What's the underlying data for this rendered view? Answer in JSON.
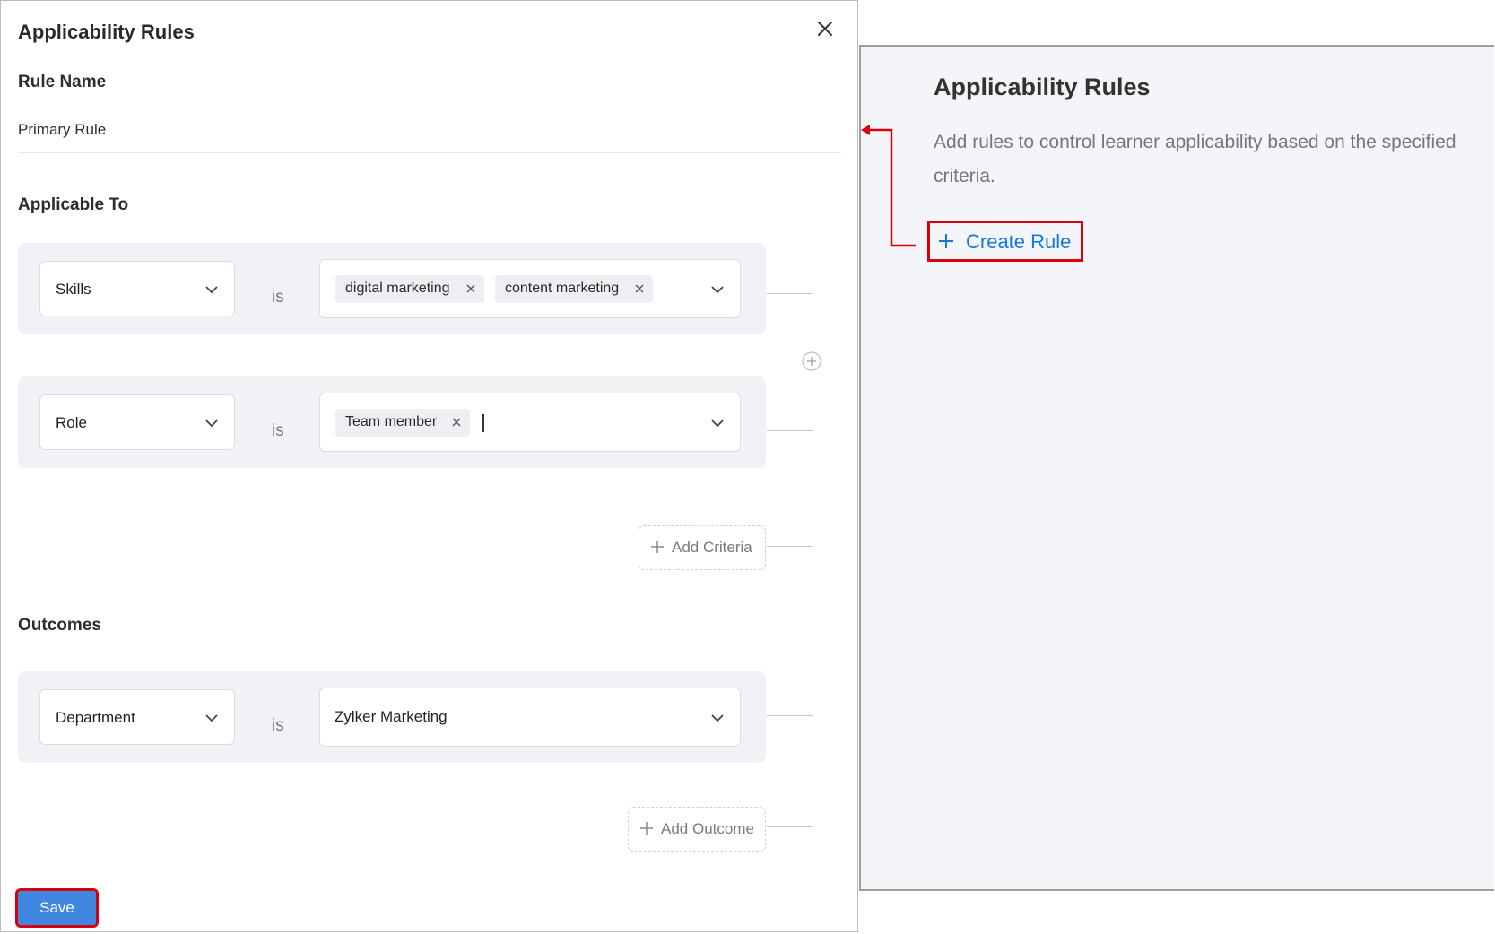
{
  "modal": {
    "title": "Applicability Rules",
    "rule_name_label": "Rule Name",
    "rule_name_value": "Primary Rule",
    "applicable_to_label": "Applicable To",
    "criteria": [
      {
        "field": "Skills",
        "operator": "is",
        "tags": [
          "digital marketing",
          "content marketing"
        ]
      },
      {
        "field": "Role",
        "operator": "is",
        "tags": [
          "Team member"
        ]
      }
    ],
    "add_criteria_label": "Add Criteria",
    "outcomes_label": "Outcomes",
    "outcome": {
      "field": "Department",
      "operator": "is",
      "value": "Zylker Marketing"
    },
    "add_outcome_label": "Add Outcome",
    "save_label": "Save"
  },
  "panel": {
    "title": "Applicability Rules",
    "description": "Add rules to control learner applicability based on the specified criteria.",
    "create_rule_label": "Create Rule"
  },
  "icons": [
    "close-icon",
    "chevron-down-icon",
    "remove-tag-icon",
    "plus-icon",
    "circle-plus-icon",
    "arrow-left-icon"
  ],
  "colors": {
    "accent": "#3f87e0",
    "link": "#1677e0",
    "highlight": "#d7000e"
  }
}
